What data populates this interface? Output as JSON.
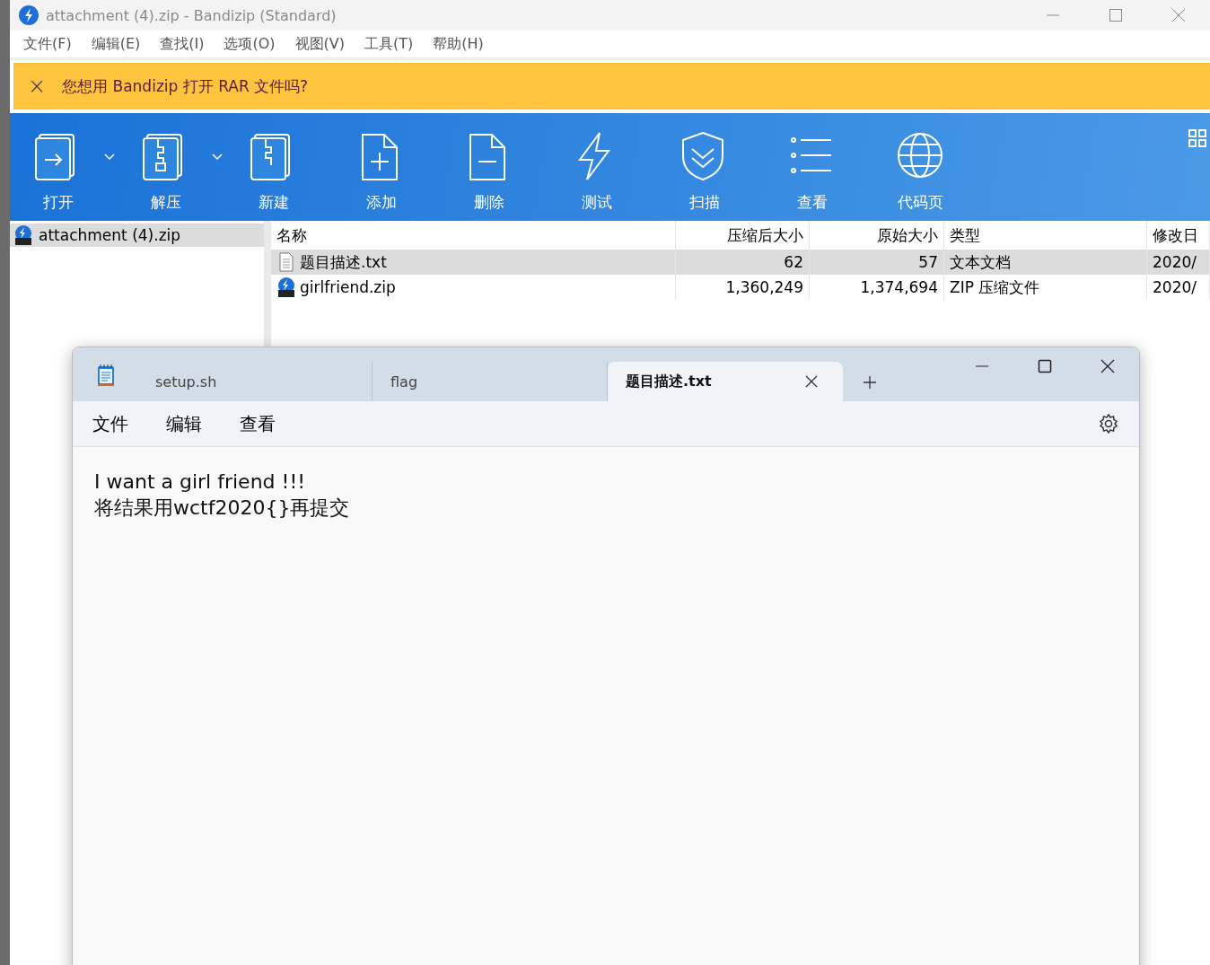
{
  "window": {
    "title": "attachment (4).zip - Bandizip (Standard)"
  },
  "menu": [
    "文件(F)",
    "编辑(E)",
    "查找(I)",
    "选项(O)",
    "视图(V)",
    "工具(T)",
    "帮助(H)"
  ],
  "banner": {
    "close": "×",
    "text": "您想用 Bandizip 打开 RAR 文件吗?"
  },
  "toolbar": [
    {
      "label": "打开",
      "dropdown": true
    },
    {
      "label": "解压",
      "dropdown": true
    },
    {
      "label": "新建",
      "dropdown": false
    },
    {
      "label": "添加",
      "dropdown": false
    },
    {
      "label": "删除",
      "dropdown": false
    },
    {
      "label": "测试",
      "dropdown": false
    },
    {
      "label": "扫描",
      "dropdown": false
    },
    {
      "label": "查看",
      "dropdown": false
    },
    {
      "label": "代码页",
      "dropdown": false
    }
  ],
  "tree": [
    {
      "label": "attachment (4).zip",
      "selected": true
    }
  ],
  "table": {
    "columns": [
      "名称",
      "压缩后大小",
      "原始大小",
      "类型",
      "修改日"
    ],
    "rows": [
      {
        "kind": "text",
        "name": "题目描述.txt",
        "packed": "62",
        "size": "57",
        "type": "文本文档",
        "modified": "2020/",
        "selected": true
      },
      {
        "kind": "zip",
        "name": "girlfriend.zip",
        "packed": "1,360,249",
        "size": "1,374,694",
        "type": "ZIP 压缩文件",
        "modified": "2020/",
        "selected": false
      }
    ]
  },
  "notepad": {
    "tabs": [
      {
        "label": "setup.sh",
        "selected": false
      },
      {
        "label": "flag",
        "selected": false
      },
      {
        "label": "题目描述.txt",
        "selected": true
      }
    ],
    "menu": [
      "文件",
      "编辑",
      "查看"
    ],
    "lines": [
      "I want a girl friend !!!",
      "将结果用wctf2020{}再提交"
    ]
  }
}
